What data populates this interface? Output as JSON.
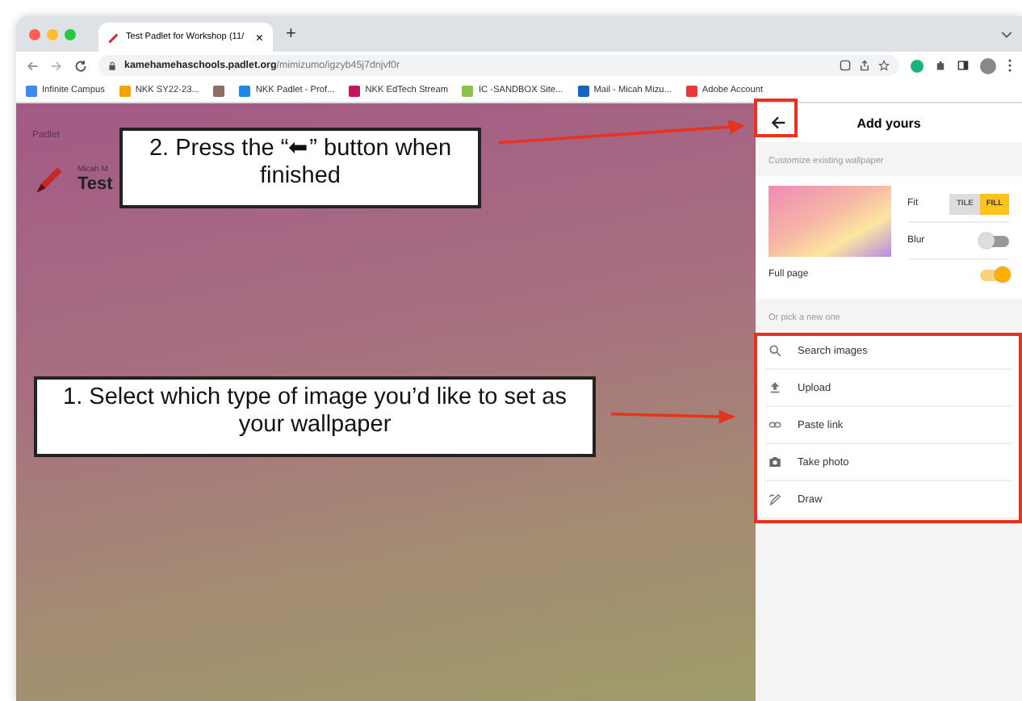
{
  "browser": {
    "tab_title": "Test Padlet for Workshop (11/",
    "tab_close": "×",
    "new_tab": "+",
    "url_host": "kamehamehaschools.padlet.org",
    "url_path": "/mimizumo/igzyb45j7dnjvf0r",
    "bookmarks": [
      {
        "label": "Infinite Campus",
        "color": "#4285f4"
      },
      {
        "label": "NKK SY22-23...",
        "color": "#f4a400"
      },
      {
        "color": "#8d6e63"
      },
      {
        "label": "NKK Padlet - Prof...",
        "color": "#1e88e5"
      },
      {
        "label": "NKK EdTech Stream",
        "color": "#c2185b"
      },
      {
        "label": "IC -SANDBOX Site...",
        "color": "#8bc34a"
      },
      {
        "label": "Mail - Micah Mizu...",
        "color": "#1565c0"
      },
      {
        "label": "Adobe Account",
        "color": "#e53935"
      }
    ]
  },
  "padlet": {
    "brand": "Padlet",
    "author": "Micah M",
    "title": "Test"
  },
  "panel": {
    "title": "Add yours",
    "section1": "Customize existing wallpaper",
    "fit": {
      "label": "Fit",
      "options": [
        {
          "label": "TILE",
          "selected": false
        },
        {
          "label": "FILL",
          "selected": true
        }
      ]
    },
    "blur": {
      "label": "Blur",
      "on": false
    },
    "full_page": {
      "label": "Full page",
      "on": true
    },
    "section2": "Or pick a new one",
    "options": [
      {
        "kind": "search",
        "label": "Search images"
      },
      {
        "kind": "upload",
        "label": "Upload"
      },
      {
        "kind": "link",
        "label": "Paste link"
      },
      {
        "kind": "camera",
        "label": "Take photo"
      },
      {
        "kind": "draw",
        "label": "Draw"
      }
    ]
  },
  "callouts": [
    {
      "text": "2. Press the “⬅” button when finished"
    },
    {
      "text": "1. Select which type of image you’d like to set as your wallpaper"
    }
  ]
}
